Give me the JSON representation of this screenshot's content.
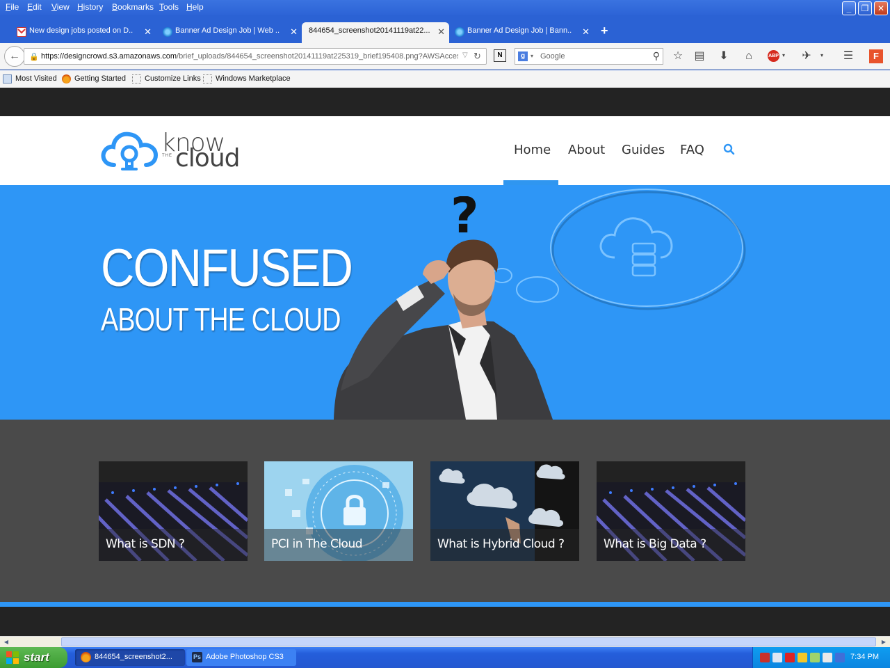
{
  "window": {
    "menu": [
      "File",
      "Edit",
      "View",
      "History",
      "Bookmarks",
      "Tools",
      "Help"
    ]
  },
  "tabs": [
    {
      "title": "New design jobs posted on D...",
      "icon": "gmail-icon",
      "active": false
    },
    {
      "title": "Banner Ad Design Job | Web ...",
      "icon": "designcrowd-icon",
      "active": false
    },
    {
      "title": "844654_screenshot20141119at22...",
      "icon": "none",
      "active": true
    },
    {
      "title": "Banner Ad Design Job | Bann...",
      "icon": "designcrowd-icon",
      "active": false
    }
  ],
  "navbar": {
    "url_host": "https://designcrowd.s3.amazonaws.com",
    "url_path": "/brief_uploads/844654_screenshot20141119at225319_brief195408.png?AWSAcces",
    "search_placeholder": "Google"
  },
  "bookmarks": [
    "Most Visited",
    "Getting Started",
    "Customize Links",
    "Windows Marketplace"
  ],
  "site": {
    "logo": {
      "line1": "know",
      "line2": "the",
      "line3": "cloud"
    },
    "nav": [
      "Home",
      "About",
      "Guides",
      "FAQ"
    ],
    "active_nav": "Home",
    "hero": {
      "title": "CONFUSED",
      "subtitle": "ABOUT THE CLOUD",
      "question_mark": "?"
    },
    "cards": [
      {
        "title": "What is SDN ?",
        "image": "network-cables"
      },
      {
        "title": "PCI in The Cloud",
        "image": "security-lock"
      },
      {
        "title": "What is Hybrid Cloud ?",
        "image": "hybrid-cloud"
      },
      {
        "title": "What is Big Data ?",
        "image": "network-cables"
      }
    ],
    "accent_color": "#2e96f6",
    "dark_color": "#232323",
    "section_color": "#4a4a4a"
  },
  "taskbar": {
    "start_label": "start",
    "tasks": [
      "844654_screenshot2...",
      "Adobe Photoshop CS3"
    ],
    "clock": "7:34 PM"
  }
}
